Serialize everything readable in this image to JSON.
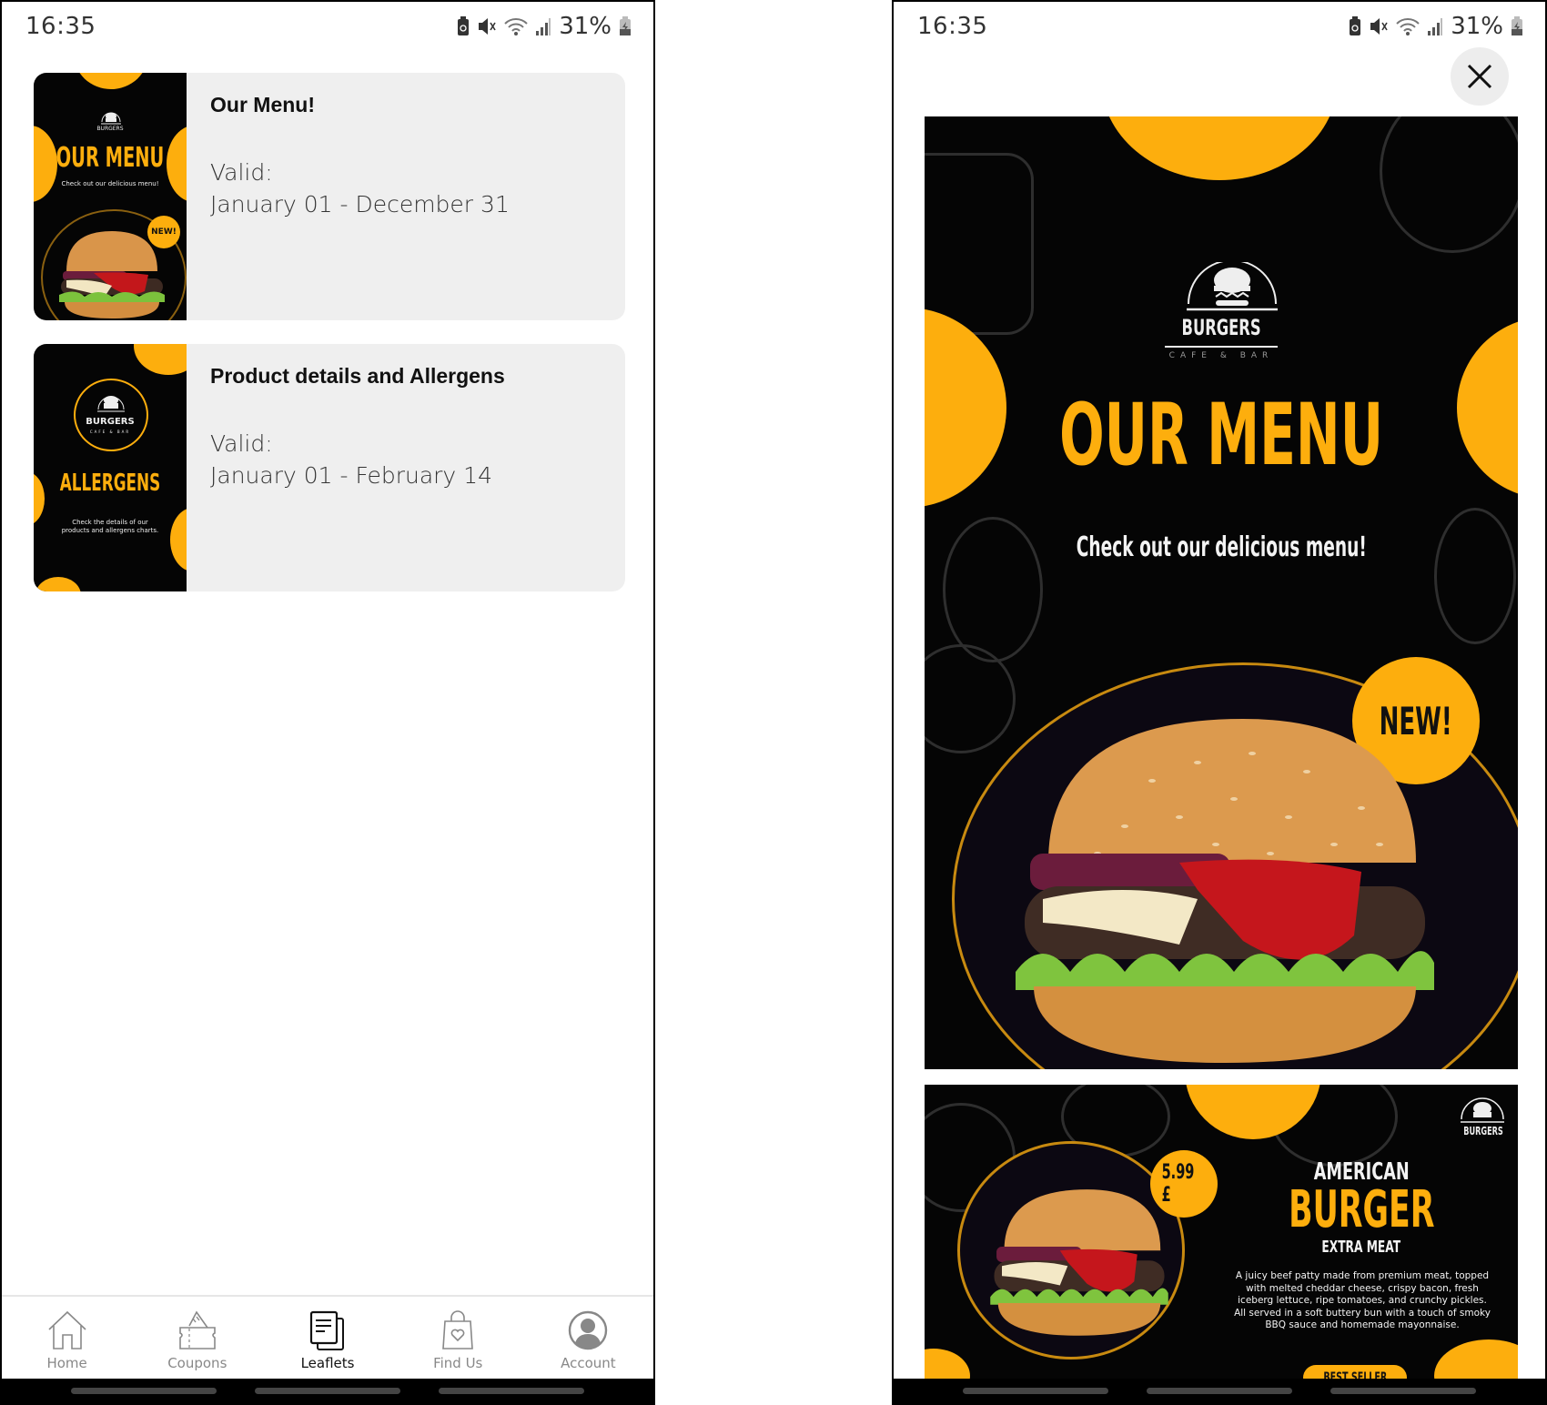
{
  "status_bar": {
    "time": "16:35",
    "battery_percent": "31%",
    "icons": [
      "battery-saver-icon",
      "mute-icon",
      "wifi-icon",
      "signal-icon",
      "battery-charging-icon"
    ]
  },
  "leaflets_screen": {
    "cards": [
      {
        "title": "Our Menu!",
        "valid_label": "Valid:",
        "valid_range": "January 01 - December 31",
        "thumbnail": {
          "brand": "BURGERS",
          "headline": "OUR MENU",
          "subline": "Check out our delicious menu!",
          "badge": "NEW!"
        }
      },
      {
        "title": "Product details and Allergens",
        "valid_label": "Valid:",
        "valid_range": "January 01 - February 14",
        "thumbnail": {
          "brand": "BURGERS",
          "brand_sub": "CAFE & BAR",
          "headline": "ALLERGENS",
          "subline": "Check the details of our products and allergens charts."
        }
      }
    ]
  },
  "bottom_nav": {
    "items": [
      {
        "label": "Home",
        "icon": "home-icon",
        "active": false
      },
      {
        "label": "Coupons",
        "icon": "coupon-icon",
        "active": false
      },
      {
        "label": "Leaflets",
        "icon": "leaflet-icon",
        "active": true
      },
      {
        "label": "Find Us",
        "icon": "shopping-bag-heart-icon",
        "active": false
      },
      {
        "label": "Account",
        "icon": "account-icon",
        "active": false
      }
    ]
  },
  "leaflet_viewer": {
    "close_icon": "close-icon",
    "page1": {
      "brand": "BURGERS",
      "brand_sub": "CAFE & BAR",
      "headline": "OUR MENU",
      "subline": "Check out our delicious menu!",
      "badge": "NEW!"
    },
    "page2": {
      "brand": "BURGERS",
      "price": "5.99 £",
      "kicker": "AMERICAN",
      "headline": "BURGER",
      "sub": "EXTRA MEAT",
      "description": "A juicy beef patty made from premium meat, topped with melted cheddar cheese, crispy bacon, fresh iceberg lettuce, ripe tomatoes, and crunchy pickles. All served in a soft buttery bun with a touch of smoky BBQ sauce and homemade mayonnaise.",
      "button": "BEST SELLER"
    }
  },
  "colors": {
    "accent_yellow": "#fdae0d",
    "card_bg": "#efefef",
    "leaflet_bg": "#050505"
  }
}
